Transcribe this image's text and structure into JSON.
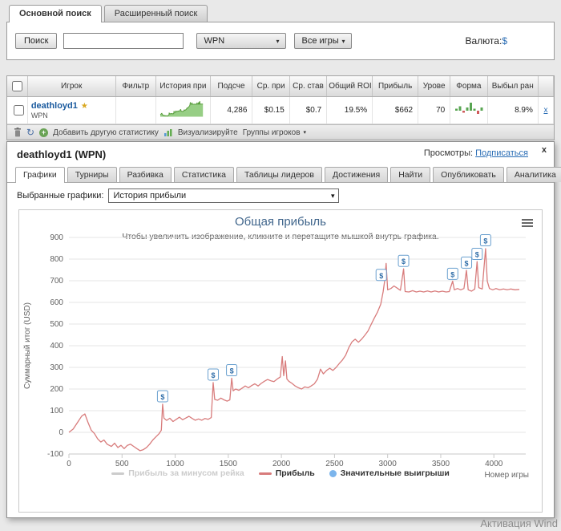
{
  "page": {
    "watermark": "Активация Wind"
  },
  "icons": {
    "chevron_down": "▾",
    "refresh": "↻",
    "add": "+",
    "medal": "★"
  },
  "search": {
    "tabs": [
      {
        "label": "Основной поиск",
        "active": true
      },
      {
        "label": "Расширенный поиск",
        "active": false
      }
    ],
    "search_button": "Поиск",
    "search_value": "",
    "network_select": "WPN",
    "games_select": "Все игры",
    "currency_label": "Валюта:",
    "currency_value": "$"
  },
  "results": {
    "columns": [
      "Игрок",
      "Фильтр",
      "История при",
      "Подсче",
      "Ср. при",
      "Ср. став",
      "Общий ROI",
      "Прибыль",
      "Урове",
      "Форма",
      "Выбыл ран"
    ],
    "row": {
      "player": "deathloyd1",
      "network": "WPN",
      "count": "4,286",
      "avg_profit": "$0.15",
      "avg_stake": "$0.7",
      "total_roi": "19.5%",
      "profit": "$662",
      "level": "70",
      "early_bust": "8.9%",
      "remove_label": "x",
      "form_spark": [
        1,
        3,
        -1,
        2,
        6,
        1,
        -2,
        2
      ]
    },
    "toolbar": {
      "add_stat_label": "Добавить другую статистику",
      "visualize_label": "Визуализируйте",
      "groups_label": "Группы игроков"
    }
  },
  "panel": {
    "title": "deathloyd1 (WPN)",
    "views_label": "Просмотры:",
    "subscribe_label": "Подписаться",
    "close_label": "x",
    "tabs": [
      {
        "label": "Графики",
        "active": true
      },
      {
        "label": "Турниры",
        "active": false
      },
      {
        "label": "Разбивка",
        "active": false
      },
      {
        "label": "Статистика",
        "active": false
      },
      {
        "label": "Таблицы лидеров",
        "active": false
      },
      {
        "label": "Достижения",
        "active": false
      },
      {
        "label": "Найти",
        "active": false
      },
      {
        "label": "Опубликовать",
        "active": false
      },
      {
        "label": "Аналитика",
        "active": false
      }
    ],
    "graph_select_label": "Выбранные графики:",
    "graph_select_value": "История прибыли"
  },
  "chart_data": {
    "type": "line",
    "title": "Общая прибыль",
    "subtitle": "Чтобы увеличить изображение, кликните и перетащите мышкой внутрь графика.",
    "xlabel": "Номер игры",
    "ylabel": "Суммарный итог (USD)",
    "xlim": [
      0,
      4300
    ],
    "ylim": [
      -100,
      900
    ],
    "xticks": [
      0,
      500,
      1000,
      1500,
      2000,
      2500,
      3000,
      3500,
      4000
    ],
    "yticks": [
      -100,
      0,
      100,
      200,
      300,
      400,
      500,
      600,
      700,
      800,
      900
    ],
    "grid": "horizontal",
    "legend_position": "bottom",
    "flag_symbol": "$",
    "legend": [
      {
        "label": "Прибыль за минусом рейка",
        "color": "#cccccc",
        "marker": "line",
        "disabled": true
      },
      {
        "label": "Прибыль",
        "color": "#d87c7c",
        "marker": "line",
        "disabled": false
      },
      {
        "label": "Значительные выигрыши",
        "color": "#7cb5ec",
        "marker": "circle",
        "disabled": false
      }
    ],
    "series": [
      {
        "name": "Прибыль",
        "color": "#d87c7c",
        "points": [
          [
            0,
            0
          ],
          [
            40,
            15
          ],
          [
            80,
            45
          ],
          [
            120,
            75
          ],
          [
            150,
            85
          ],
          [
            180,
            45
          ],
          [
            210,
            10
          ],
          [
            240,
            -5
          ],
          [
            270,
            -30
          ],
          [
            300,
            -45
          ],
          [
            330,
            -35
          ],
          [
            360,
            -55
          ],
          [
            400,
            -65
          ],
          [
            430,
            -50
          ],
          [
            460,
            -70
          ],
          [
            490,
            -60
          ],
          [
            520,
            -75
          ],
          [
            550,
            -60
          ],
          [
            580,
            -55
          ],
          [
            610,
            -65
          ],
          [
            640,
            -75
          ],
          [
            670,
            -85
          ],
          [
            700,
            -80
          ],
          [
            730,
            -70
          ],
          [
            760,
            -55
          ],
          [
            790,
            -35
          ],
          [
            820,
            -20
          ],
          [
            850,
            -5
          ],
          [
            870,
            10
          ],
          [
            882,
            130
          ],
          [
            895,
            65
          ],
          [
            920,
            55
          ],
          [
            950,
            65
          ],
          [
            980,
            50
          ],
          [
            1010,
            60
          ],
          [
            1040,
            70
          ],
          [
            1070,
            58
          ],
          [
            1100,
            66
          ],
          [
            1130,
            74
          ],
          [
            1160,
            64
          ],
          [
            1190,
            56
          ],
          [
            1220,
            62
          ],
          [
            1250,
            56
          ],
          [
            1280,
            64
          ],
          [
            1310,
            60
          ],
          [
            1340,
            68
          ],
          [
            1358,
            230
          ],
          [
            1372,
            152
          ],
          [
            1400,
            148
          ],
          [
            1430,
            158
          ],
          [
            1460,
            150
          ],
          [
            1490,
            144
          ],
          [
            1515,
            150
          ],
          [
            1532,
            250
          ],
          [
            1546,
            192
          ],
          [
            1570,
            200
          ],
          [
            1600,
            194
          ],
          [
            1630,
            204
          ],
          [
            1660,
            214
          ],
          [
            1690,
            206
          ],
          [
            1720,
            216
          ],
          [
            1750,
            224
          ],
          [
            1780,
            214
          ],
          [
            1810,
            226
          ],
          [
            1840,
            236
          ],
          [
            1870,
            244
          ],
          [
            1900,
            238
          ],
          [
            1930,
            234
          ],
          [
            1960,
            246
          ],
          [
            1990,
            256
          ],
          [
            2008,
            350
          ],
          [
            2022,
            262
          ],
          [
            2038,
            330
          ],
          [
            2052,
            246
          ],
          [
            2070,
            236
          ],
          [
            2100,
            226
          ],
          [
            2130,
            214
          ],
          [
            2160,
            206
          ],
          [
            2190,
            200
          ],
          [
            2220,
            210
          ],
          [
            2250,
            206
          ],
          [
            2280,
            214
          ],
          [
            2310,
            224
          ],
          [
            2340,
            246
          ],
          [
            2368,
            292
          ],
          [
            2395,
            270
          ],
          [
            2425,
            286
          ],
          [
            2455,
            296
          ],
          [
            2485,
            286
          ],
          [
            2515,
            300
          ],
          [
            2545,
            318
          ],
          [
            2575,
            334
          ],
          [
            2605,
            356
          ],
          [
            2635,
            392
          ],
          [
            2665,
            418
          ],
          [
            2695,
            430
          ],
          [
            2725,
            416
          ],
          [
            2755,
            430
          ],
          [
            2785,
            448
          ],
          [
            2815,
            468
          ],
          [
            2845,
            498
          ],
          [
            2875,
            528
          ],
          [
            2905,
            556
          ],
          [
            2935,
            592
          ],
          [
            2958,
            650
          ],
          [
            2972,
            700
          ],
          [
            2986,
            780
          ],
          [
            3000,
            658
          ],
          [
            3030,
            664
          ],
          [
            3060,
            676
          ],
          [
            3090,
            666
          ],
          [
            3120,
            656
          ],
          [
            3150,
            755
          ],
          [
            3165,
            650
          ],
          [
            3200,
            648
          ],
          [
            3235,
            654
          ],
          [
            3270,
            648
          ],
          [
            3305,
            652
          ],
          [
            3340,
            648
          ],
          [
            3375,
            653
          ],
          [
            3410,
            648
          ],
          [
            3445,
            653
          ],
          [
            3480,
            648
          ],
          [
            3515,
            652
          ],
          [
            3550,
            648
          ],
          [
            3580,
            650
          ],
          [
            3612,
            698
          ],
          [
            3628,
            658
          ],
          [
            3658,
            664
          ],
          [
            3688,
            658
          ],
          [
            3718,
            664
          ],
          [
            3742,
            748
          ],
          [
            3758,
            658
          ],
          [
            3790,
            652
          ],
          [
            3820,
            662
          ],
          [
            3842,
            788
          ],
          [
            3858,
            668
          ],
          [
            3890,
            662
          ],
          [
            3922,
            848
          ],
          [
            3938,
            698
          ],
          [
            3958,
            664
          ],
          [
            3990,
            658
          ],
          [
            4020,
            664
          ],
          [
            4055,
            658
          ],
          [
            4090,
            662
          ],
          [
            4125,
            658
          ],
          [
            4160,
            662
          ],
          [
            4200,
            658
          ],
          [
            4240,
            660
          ]
        ]
      }
    ],
    "significant_wins": [
      [
        882,
        165
      ],
      [
        1358,
        265
      ],
      [
        1532,
        285
      ],
      [
        2940,
        725
      ],
      [
        3150,
        790
      ],
      [
        3612,
        730
      ],
      [
        3742,
        782
      ],
      [
        3842,
        822
      ],
      [
        3922,
        885
      ]
    ]
  }
}
